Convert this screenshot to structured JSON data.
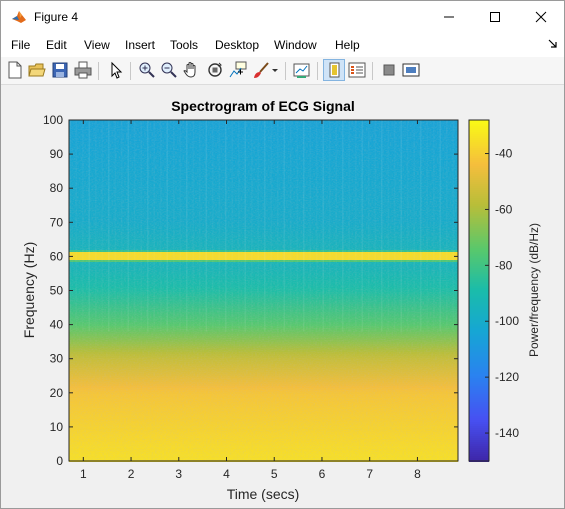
{
  "window": {
    "title": "Figure 4",
    "minimize_glyph": "—",
    "maximize_glyph": "☐",
    "close_glyph": "✕"
  },
  "menu": {
    "items": [
      "File",
      "Edit",
      "View",
      "Insert",
      "Tools",
      "Desktop",
      "Window",
      "Help"
    ],
    "dock_glyph": "↘"
  },
  "toolbar": {
    "icons": [
      "new-figure-icon",
      "open-file-icon",
      "save-icon",
      "print-icon",
      "edit-plot-icon",
      "zoom-in-icon",
      "zoom-out-icon",
      "pan-icon",
      "rotate-3d-icon",
      "data-cursor-icon",
      "brush-icon",
      "brush-dropdown-icon",
      "link-plot-icon",
      "insert-colorbar-icon",
      "insert-legend-icon",
      "hide-plot-tools-icon",
      "show-plot-tools-icon"
    ]
  },
  "chart_data": {
    "type": "heatmap",
    "title": "Spectrogram of ECG Signal",
    "xlabel": "Time (secs)",
    "ylabel": "Frequency (Hz)",
    "xlim": [
      0.7,
      8.85
    ],
    "ylim": [
      0,
      100
    ],
    "xticks": [
      "1",
      "2",
      "3",
      "4",
      "5",
      "6",
      "7",
      "8"
    ],
    "yticks": [
      "0",
      "10",
      "20",
      "30",
      "40",
      "50",
      "60",
      "70",
      "80",
      "90",
      "100"
    ],
    "colorbar": {
      "label": "Power/frequency (dB/Hz)",
      "range": [
        -150,
        -28
      ],
      "ticks": [
        "-40",
        "-60",
        "-80",
        "-100",
        "-120",
        "-140"
      ],
      "colormap": "parula"
    },
    "features": {
      "powerline_band_hz": 60,
      "power_db_by_frequency": [
        {
          "hz": 0,
          "db": -35
        },
        {
          "hz": 20,
          "db": -42
        },
        {
          "hz": 30,
          "db": -55
        },
        {
          "hz": 40,
          "db": -75
        },
        {
          "hz": 50,
          "db": -88
        },
        {
          "hz": 58,
          "db": -95
        },
        {
          "hz": 60,
          "db": -38
        },
        {
          "hz": 62,
          "db": -95
        },
        {
          "hz": 70,
          "db": -100
        },
        {
          "hz": 100,
          "db": -105
        }
      ]
    }
  }
}
